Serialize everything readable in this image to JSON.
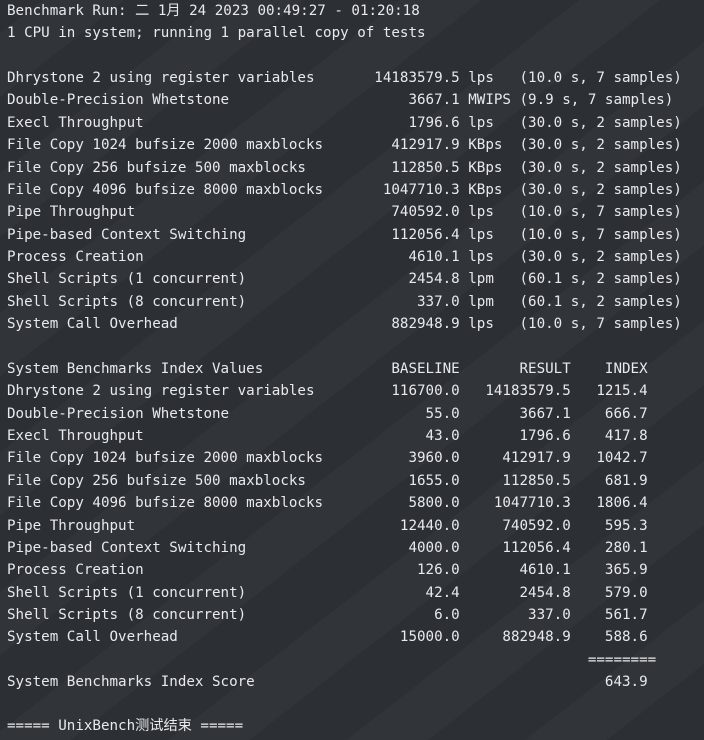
{
  "terminal": {
    "header": {
      "run": "Benchmark Run: 二 1月 24 2023 00:49:27 - 01:20:18",
      "cpu": "1 CPU in system; running 1 parallel copy of tests"
    },
    "results": [
      "Dhrystone 2 using register variables       14183579.5 lps   (10.0 s, 7 samples)",
      "Double-Precision Whetstone                     3667.1 MWIPS (9.9 s, 7 samples)",
      "Execl Throughput                               1796.6 lps   (30.0 s, 2 samples)",
      "File Copy 1024 bufsize 2000 maxblocks        412917.9 KBps  (30.0 s, 2 samples)",
      "File Copy 256 bufsize 500 maxblocks          112850.5 KBps  (30.0 s, 2 samples)",
      "File Copy 4096 bufsize 8000 maxblocks       1047710.3 KBps  (30.0 s, 2 samples)",
      "Pipe Throughput                              740592.0 lps   (10.0 s, 7 samples)",
      "Pipe-based Context Switching                 112056.4 lps   (10.0 s, 7 samples)",
      "Process Creation                               4610.1 lps   (30.0 s, 2 samples)",
      "Shell Scripts (1 concurrent)                   2454.8 lpm   (60.1 s, 2 samples)",
      "Shell Scripts (8 concurrent)                    337.0 lpm   (60.1 s, 2 samples)",
      "System Call Overhead                         882948.9 lps   (10.0 s, 7 samples)"
    ],
    "index_header": "System Benchmarks Index Values               BASELINE       RESULT    INDEX",
    "index_rows": [
      "Dhrystone 2 using register variables         116700.0   14183579.5   1215.4",
      "Double-Precision Whetstone                       55.0       3667.1    666.7",
      "Execl Throughput                                 43.0       1796.6    417.8",
      "File Copy 1024 bufsize 2000 maxblocks          3960.0     412917.9   1042.7",
      "File Copy 256 bufsize 500 maxblocks            1655.0     112850.5    681.9",
      "File Copy 4096 bufsize 8000 maxblocks          5800.0    1047710.3   1806.4",
      "Pipe Throughput                               12440.0     740592.0    595.3",
      "Pipe-based Context Switching                   4000.0     112056.4    280.1",
      "Process Creation                                126.0       4610.1    365.9",
      "Shell Scripts (1 concurrent)                     42.4       2454.8    579.0",
      "Shell Scripts (8 concurrent)                      6.0        337.0    561.7",
      "System Call Overhead                          15000.0     882948.9    588.6"
    ],
    "separator": "                                                                    ========",
    "score_line": "System Benchmarks Index Score                                         643.9",
    "footer": "===== UnixBench测试结束 ====="
  }
}
